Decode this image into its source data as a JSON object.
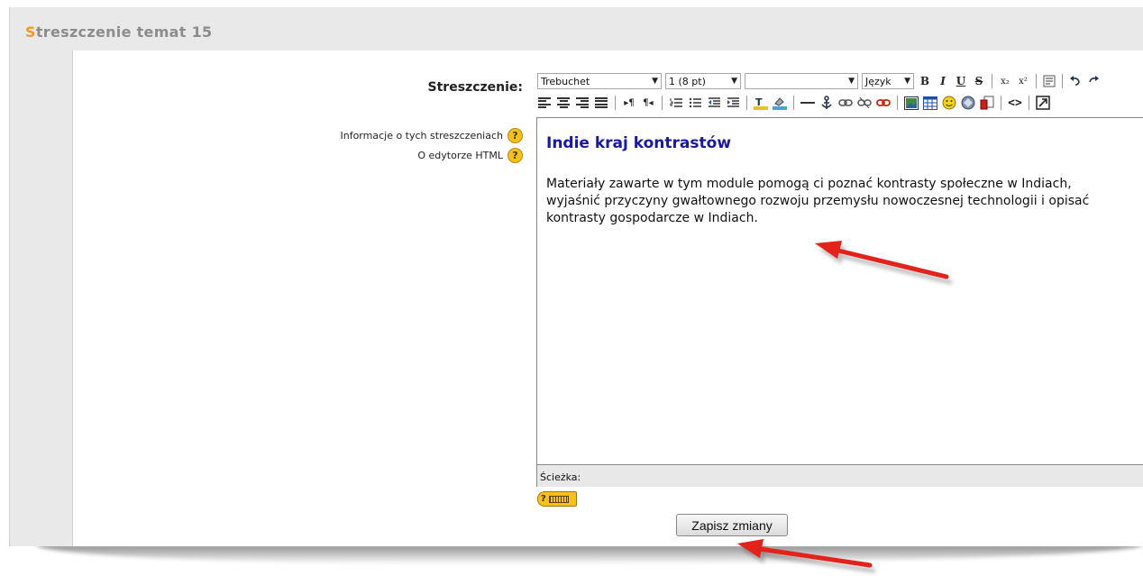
{
  "section": {
    "title_first": "S",
    "title_rest": "treszczenie temat 15"
  },
  "form": {
    "field_label": "Streszczenie:",
    "help": [
      {
        "text": "Informacje o tych streszczeniach",
        "icon": "?"
      },
      {
        "text": "O edytorze HTML",
        "icon": "?"
      }
    ]
  },
  "toolbar": {
    "font_family": "Trebuchet",
    "font_size": "1 (8 pt)",
    "format": "",
    "language": "Język",
    "bold": "B",
    "italic": "I",
    "underline": "U",
    "strike": "S",
    "subscript": "x₂",
    "superscript": "x²"
  },
  "editor": {
    "heading": "Indie kraj kontrastów",
    "body": "Materiały zawarte w tym module pomogą ci poznać kontrasty społeczne w Indiach, wyjaśnić przyczyny gwałtownego rozwoju przemysłu nowoczesnej technologii i opisać kontrasty gospodarcze w Indiach."
  },
  "path_bar": {
    "label": "Ścieżka:"
  },
  "keyboard_help": {
    "icon": "?"
  },
  "save_button": {
    "label": "Zapisz zmiany"
  },
  "colors": {
    "title_accent": "#f29a1a",
    "heading": "#1717a8",
    "arrow": "#e3201b"
  }
}
